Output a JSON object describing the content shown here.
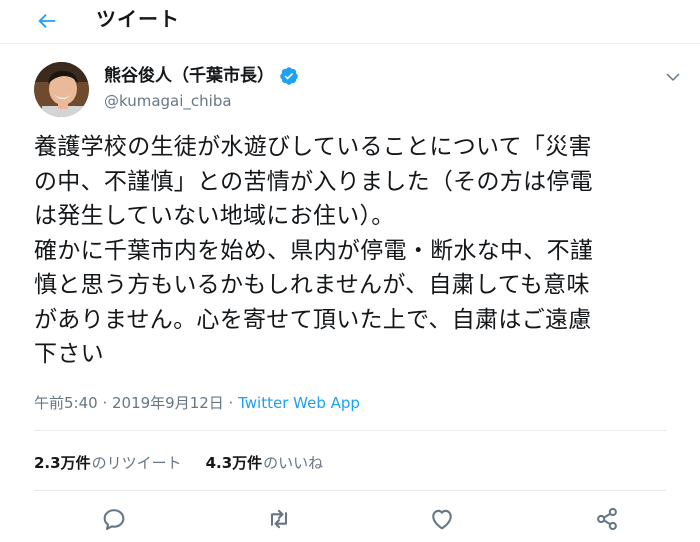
{
  "header": {
    "title": "ツイート"
  },
  "author": {
    "name": "熊谷俊人（千葉市長）",
    "handle": "@kumagai_chiba"
  },
  "tweet": {
    "text": "養護学校の生徒が水遊びしていることについて「災害\nの中、不謹慎」との苦情が入りました（その方は停電\nは発生していない地域にお住い）。\n確かに千葉市内を始め、県内が停電・断水な中、不謹\n慎と思う方もいるかもしれませんが、自粛しても意味\nがありません。心を寄せて頂いた上で、自粛はご遠慮\n下さい",
    "time": "午前5:40 · 2019年9月12日 · ",
    "app": "Twitter Web App"
  },
  "stats": {
    "retweets_count": "2.3万件",
    "retweets_label": "のリツイート",
    "likes_count": "4.3万件",
    "likes_label": "のいいね"
  },
  "icons": {
    "back": "arrow-left-icon",
    "verified": "verified-badge-icon",
    "more": "chevron-down-icon",
    "reply": "reply-icon",
    "retweet": "retweet-icon",
    "like": "heart-icon",
    "share": "share-icon"
  },
  "colors": {
    "accent": "#1da1f2",
    "secondary_text": "#657786",
    "icon_gray": "#657786",
    "divider": "#e6ecf0"
  }
}
